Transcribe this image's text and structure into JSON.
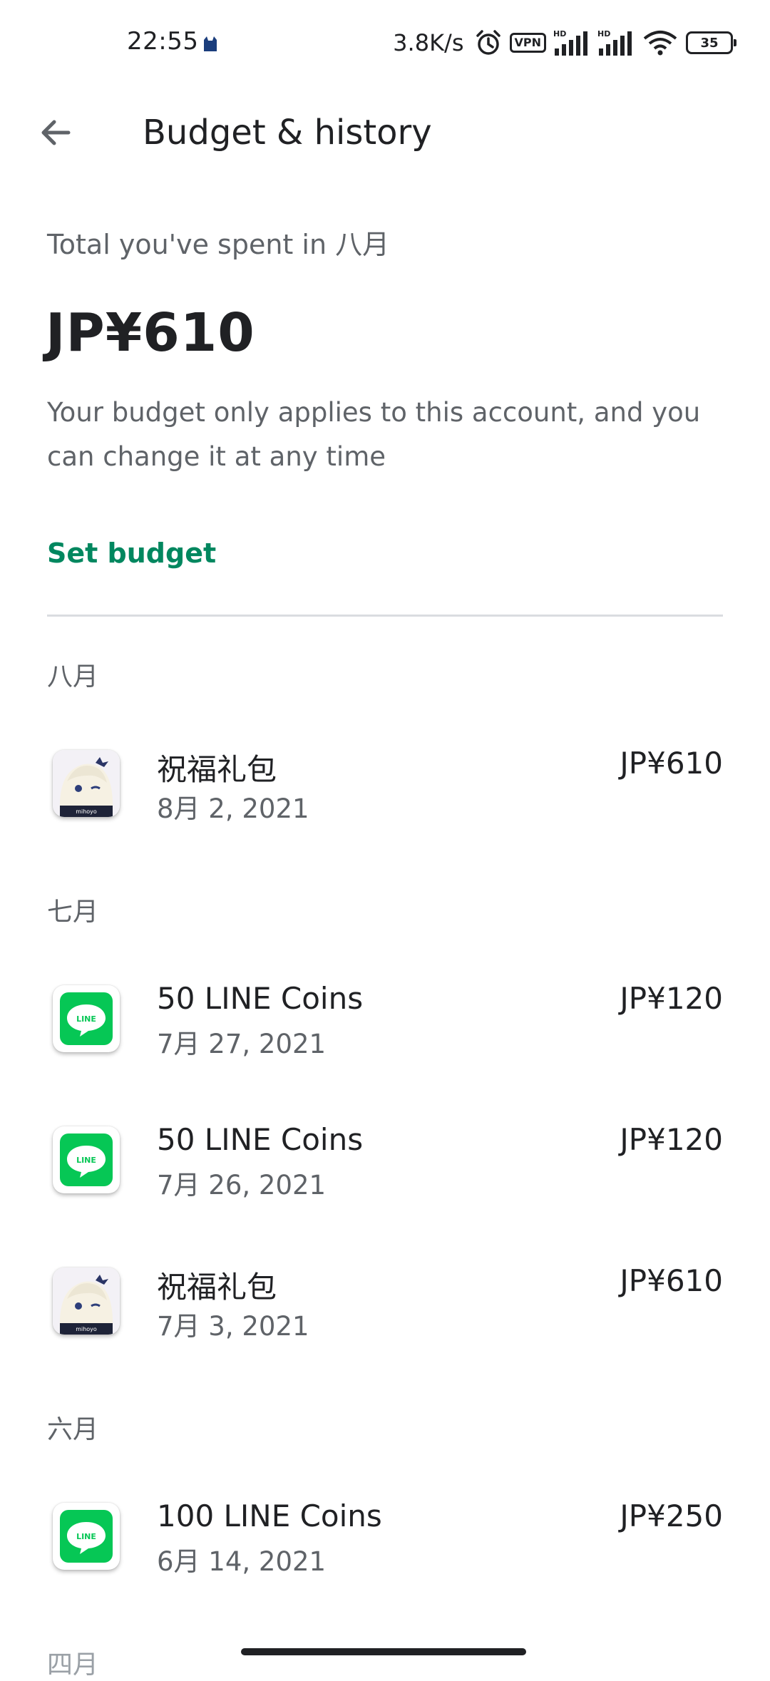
{
  "status_bar": {
    "time": "22:55",
    "net_speed": "3.8K/s",
    "vpn": "VPN",
    "battery": "35"
  },
  "app_bar": {
    "title": "Budget & history"
  },
  "summary": {
    "label": "Total you've spent in 八月",
    "amount": "JP¥610",
    "description": "Your budget only applies to this account, and you can change it at any time",
    "set_budget": "Set budget"
  },
  "groups": [
    {
      "month": "八月",
      "items": [
        {
          "title": "祝福礼包",
          "date": "8月 2, 2021",
          "amount": "JP¥610",
          "icon": "genshin-app-icon"
        }
      ]
    },
    {
      "month": "七月",
      "items": [
        {
          "title": "50 LINE Coins",
          "date": "7月 27, 2021",
          "amount": "JP¥120",
          "icon": "line-app-icon"
        },
        {
          "title": "50 LINE Coins",
          "date": "7月 26, 2021",
          "amount": "JP¥120",
          "icon": "line-app-icon"
        },
        {
          "title": "祝福礼包",
          "date": "7月 3, 2021",
          "amount": "JP¥610",
          "icon": "genshin-app-icon"
        }
      ]
    },
    {
      "month": "六月",
      "items": [
        {
          "title": "100 LINE Coins",
          "date": "6月 14, 2021",
          "amount": "JP¥250",
          "icon": "line-app-icon"
        }
      ]
    },
    {
      "month": "四月",
      "items": []
    }
  ],
  "colors": {
    "accent": "#01875f",
    "line_green": "#06c755",
    "text_primary": "#202124",
    "text_secondary": "#5f6368"
  }
}
